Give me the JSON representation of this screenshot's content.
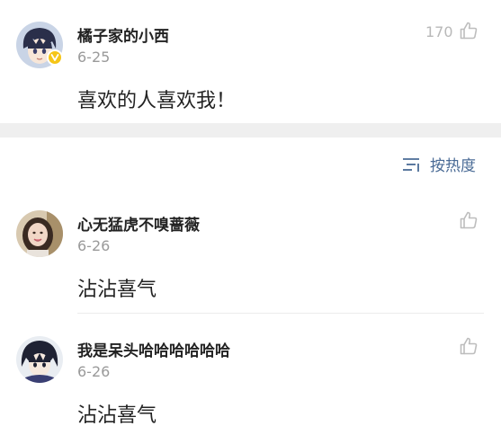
{
  "top_comment": {
    "username": "橘子家的小西",
    "date": "6-25",
    "text": "喜欢的人喜欢我！",
    "likes": "170",
    "avatar_icon": "anime-boy-avatar",
    "badge_icon": "verified-v-badge"
  },
  "sort": {
    "label": "按热度",
    "icon": "sort-lines-icon"
  },
  "comments": [
    {
      "username": "心无猛虎不嗅蔷薇",
      "date": "6-26",
      "text": "沾沾喜气",
      "avatar_icon": "girl-photo-avatar"
    },
    {
      "username": "我是呆头哈哈哈哈哈哈",
      "date": "6-26",
      "text": "沾沾喜气",
      "avatar_icon": "anime-ninja-avatar"
    }
  ],
  "colors": {
    "badge": "#f5c518",
    "sort_accent": "#4a6b96",
    "separator": "#efefef"
  }
}
